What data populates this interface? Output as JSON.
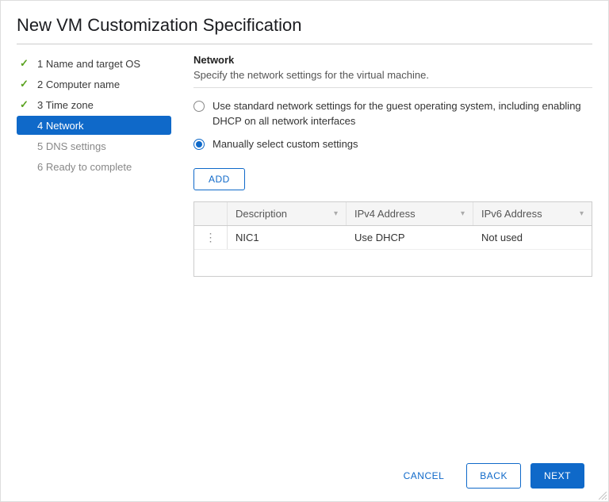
{
  "dialog": {
    "title": "New VM Customization Specification"
  },
  "sidebar": {
    "steps": [
      {
        "label": "1 Name and target OS",
        "state": "done"
      },
      {
        "label": "2 Computer name",
        "state": "done"
      },
      {
        "label": "3 Time zone",
        "state": "done"
      },
      {
        "label": "4 Network",
        "state": "active"
      },
      {
        "label": "5 DNS settings",
        "state": "pending"
      },
      {
        "label": "6 Ready to complete",
        "state": "pending"
      }
    ]
  },
  "content": {
    "heading": "Network",
    "description": "Specify the network settings for the virtual machine.",
    "option_standard": "Use standard network settings for the guest operating system, including enabling DHCP on all network interfaces",
    "option_manual": "Manually select custom settings",
    "add_button": "ADD",
    "table": {
      "columns": {
        "description": "Description",
        "ipv4": "IPv4 Address",
        "ipv6": "IPv6 Address"
      },
      "rows": [
        {
          "description": "NIC1",
          "ipv4": "Use DHCP",
          "ipv6": "Not used"
        }
      ]
    }
  },
  "footer": {
    "cancel": "CANCEL",
    "back": "BACK",
    "next": "NEXT"
  }
}
